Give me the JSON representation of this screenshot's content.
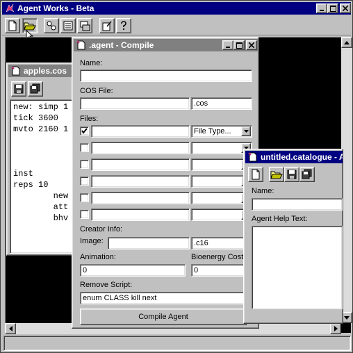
{
  "main_window": {
    "title": "Agent Works - Beta",
    "toolbar": [
      {
        "icon": "new-file-icon"
      },
      {
        "icon": "open-folder-icon"
      },
      {
        "icon": "agent-injector-icon"
      },
      {
        "icon": "organizer-icon"
      },
      {
        "icon": "compile-icon"
      },
      {
        "icon": "edit-catalogue-icon"
      },
      {
        "icon": "help-icon"
      }
    ]
  },
  "apples_window": {
    "title": "apples.cos",
    "code_lines": [
      "new: simp 1",
      "tick 3600",
      "mvto 2160 1",
      "",
      "",
      "",
      "inst",
      "reps 10",
      "        new",
      "        att",
      "        bhv"
    ]
  },
  "compile_window": {
    "title": ".agent - Compile",
    "name_label": "Name:",
    "name_value": "",
    "cos_label": "COS File:",
    "cos_value": "",
    "cos_ext": ".cos",
    "files_label": "Files:",
    "files": [
      {
        "checked": true,
        "value": "",
        "type": "File Type..."
      },
      {
        "checked": false,
        "value": "",
        "type": ""
      },
      {
        "checked": false,
        "value": "",
        "type": ""
      },
      {
        "checked": false,
        "value": "",
        "type": ""
      },
      {
        "checked": false,
        "value": "",
        "type": ""
      },
      {
        "checked": false,
        "value": "",
        "type": ""
      }
    ],
    "creator_label": "Creator Info:",
    "image_label": "Image:",
    "image_value": "",
    "image_ext": ".c16",
    "animation_label": "Animation:",
    "animation_value": "0",
    "bioenergy_label": "Bioenergy Cost:",
    "bioenergy_value": "0",
    "remove_label": "Remove Script:",
    "remove_value": "enum CLASS kill next",
    "compile_button": "Compile Agent"
  },
  "catalogue_window": {
    "title": "untitled.catalogue - A",
    "name_label": "Name:",
    "name_value": "",
    "help_label": "Agent Help Text:",
    "help_value": ""
  },
  "colors": {
    "title_active": "#000080",
    "face": "#c0c0c0",
    "desktop": "#000000"
  }
}
